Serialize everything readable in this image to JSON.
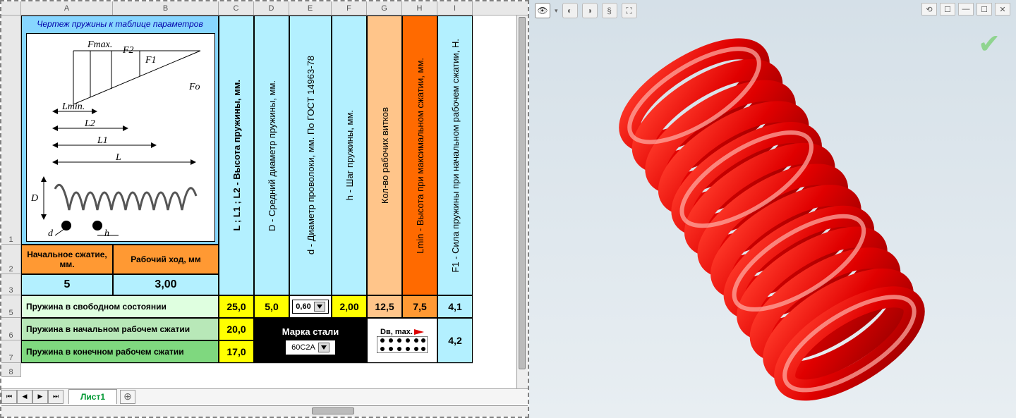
{
  "columns": [
    "A",
    "B",
    "C",
    "D",
    "E",
    "F",
    "G",
    "H",
    "I"
  ],
  "rows": [
    "1",
    "2",
    "3",
    "5",
    "6",
    "7",
    "8"
  ],
  "diagram_title": "Чертеж пружины к таблице параметров",
  "diagram_labels": {
    "Fmax": "Fmax.",
    "F2": "F2",
    "F1": "F1",
    "Fo": "Fo",
    "Lmin": "Lmin.",
    "L2": "L2",
    "L1": "L1",
    "L": "L",
    "D": "D",
    "d": "d",
    "h": "h"
  },
  "vheaders": {
    "C": "L ; L1 ; L2 - Высота пружины, мм.",
    "D": "D - Средний диаметр пружины, мм.",
    "E": "d - Диаметр проволоки, мм.     По ГОСТ 14963-78",
    "F": "h - Шаг пружины, мм.",
    "G": "Кол-во рабочих витков",
    "H": "Lmin - Высота при максимальном сжатии, мм.",
    "I": "F1 - Сила пружины при начальном рабочем сжатии, Н."
  },
  "labels": {
    "a2": "Начальное сжатие, мм.",
    "b2": "Рабочий ход, мм",
    "ab5": "Пружина в свободном состоянии",
    "ab6": "Пружина в начальном рабочем сжатии",
    "ab7": "Пружина в конечном рабочем сжатии",
    "steel": "Марка стали",
    "dmax": "Dв, max."
  },
  "values": {
    "a3": "5",
    "b3": "3,00",
    "c5": "25,0",
    "d5": "5,0",
    "e5": "0,60",
    "f5": "2,00",
    "g5": "12,5",
    "h5": "7,5",
    "i5": "4,1",
    "c6": "20,0",
    "c7": "17,0",
    "i67": "4,2",
    "steel_grade": "60С2А"
  },
  "sheet_tab": "Лист1",
  "add_sheet": "⊕",
  "viewer_icons": [
    "eye-icon",
    "sphere-icon",
    "sphere2-icon",
    "spring-icon",
    "expand-icon"
  ],
  "win_icons": [
    "restore-icon",
    "window-icon",
    "minimize-icon",
    "maximize-icon",
    "close-icon"
  ]
}
